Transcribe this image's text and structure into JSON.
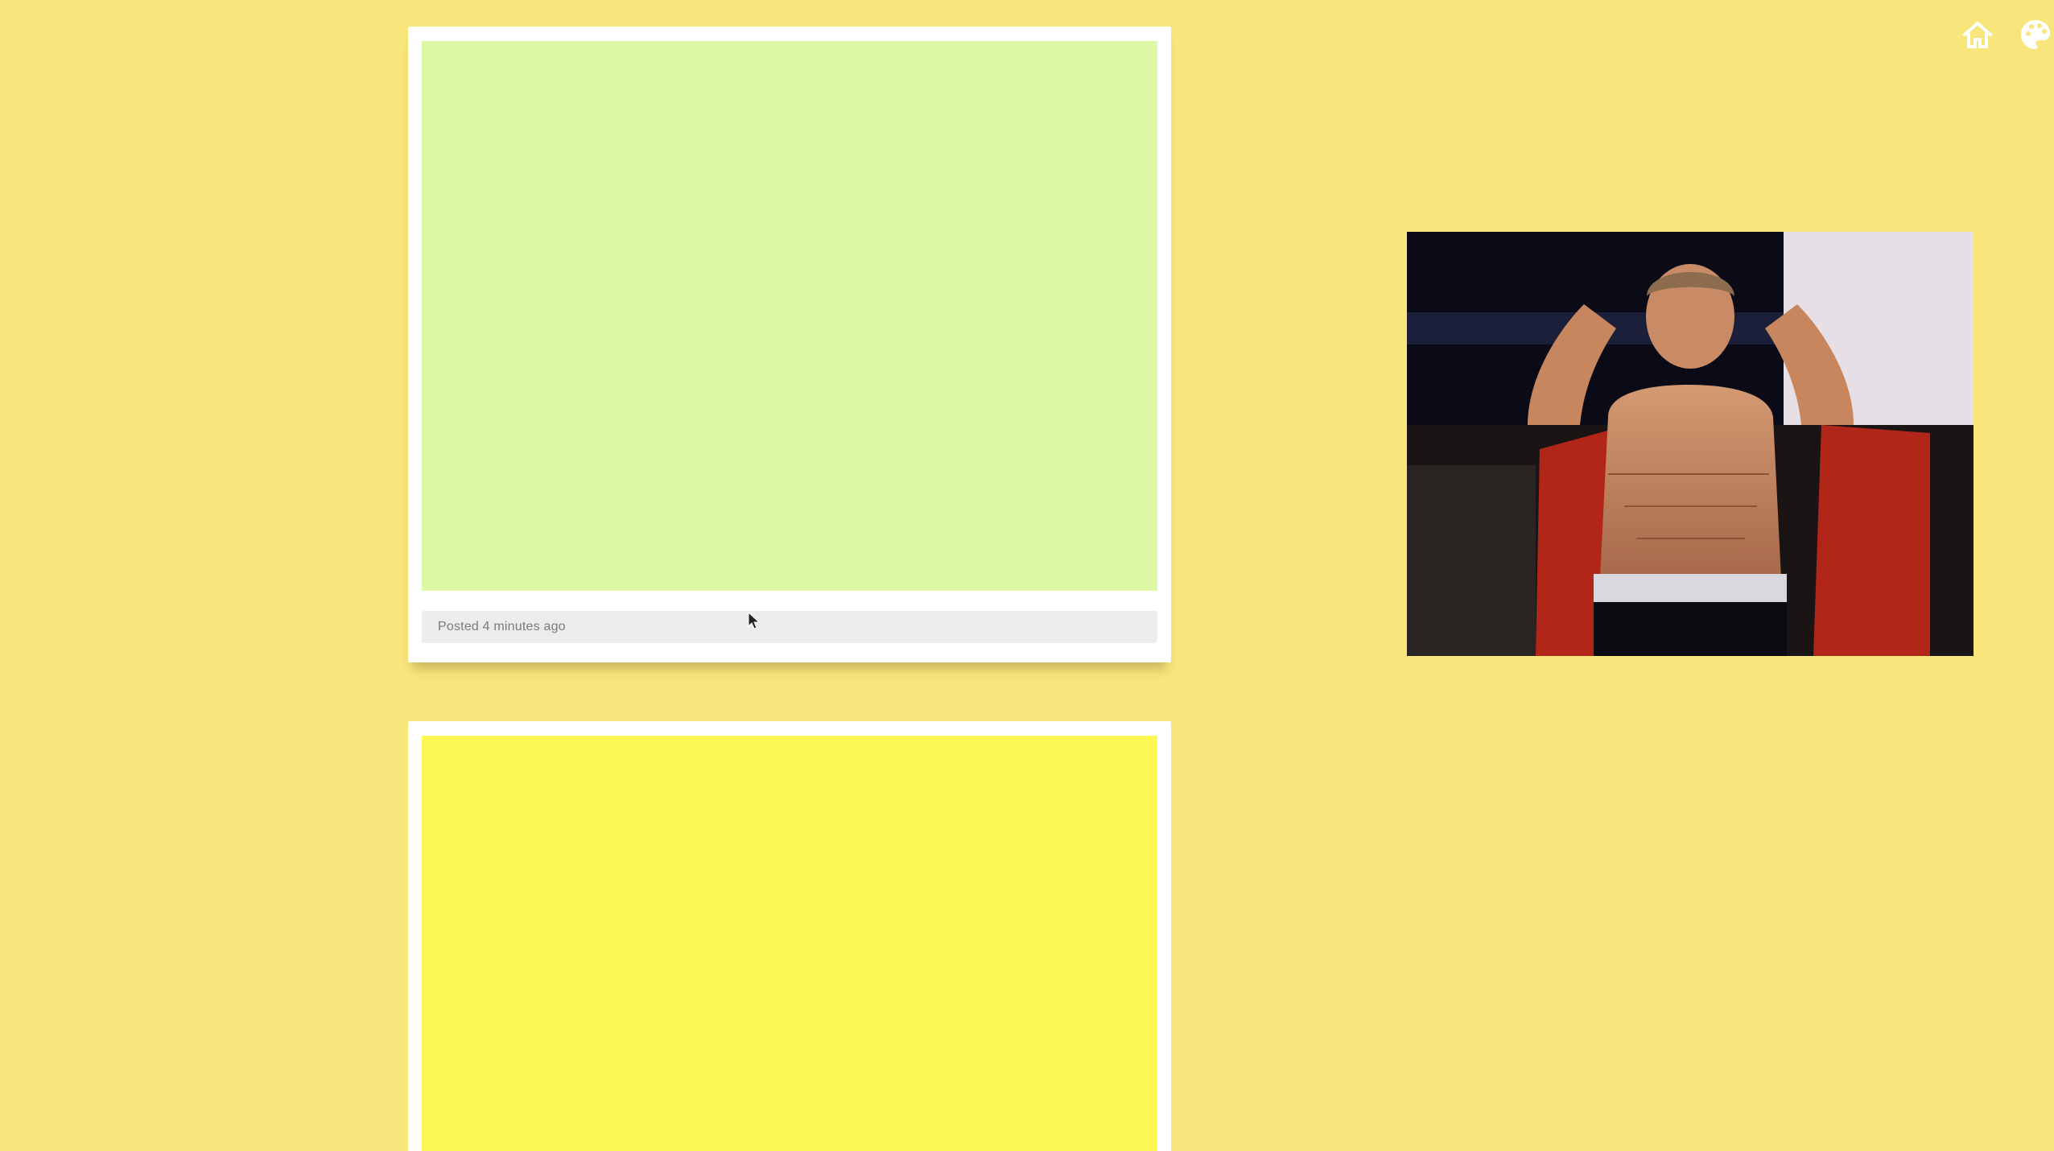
{
  "colors": {
    "background": "#f8e57b",
    "card_first_fill": "#dcf8a4",
    "card_second_fill": "#fdf755",
    "footer_bg": "#ececec"
  },
  "header": {
    "icons": [
      "home-icon",
      "palette-icon"
    ]
  },
  "posts": [
    {
      "meta": "Posted 4 minutes ago"
    },
    {
      "meta": ""
    }
  ],
  "video": {
    "content": "webcam-video-feed"
  }
}
